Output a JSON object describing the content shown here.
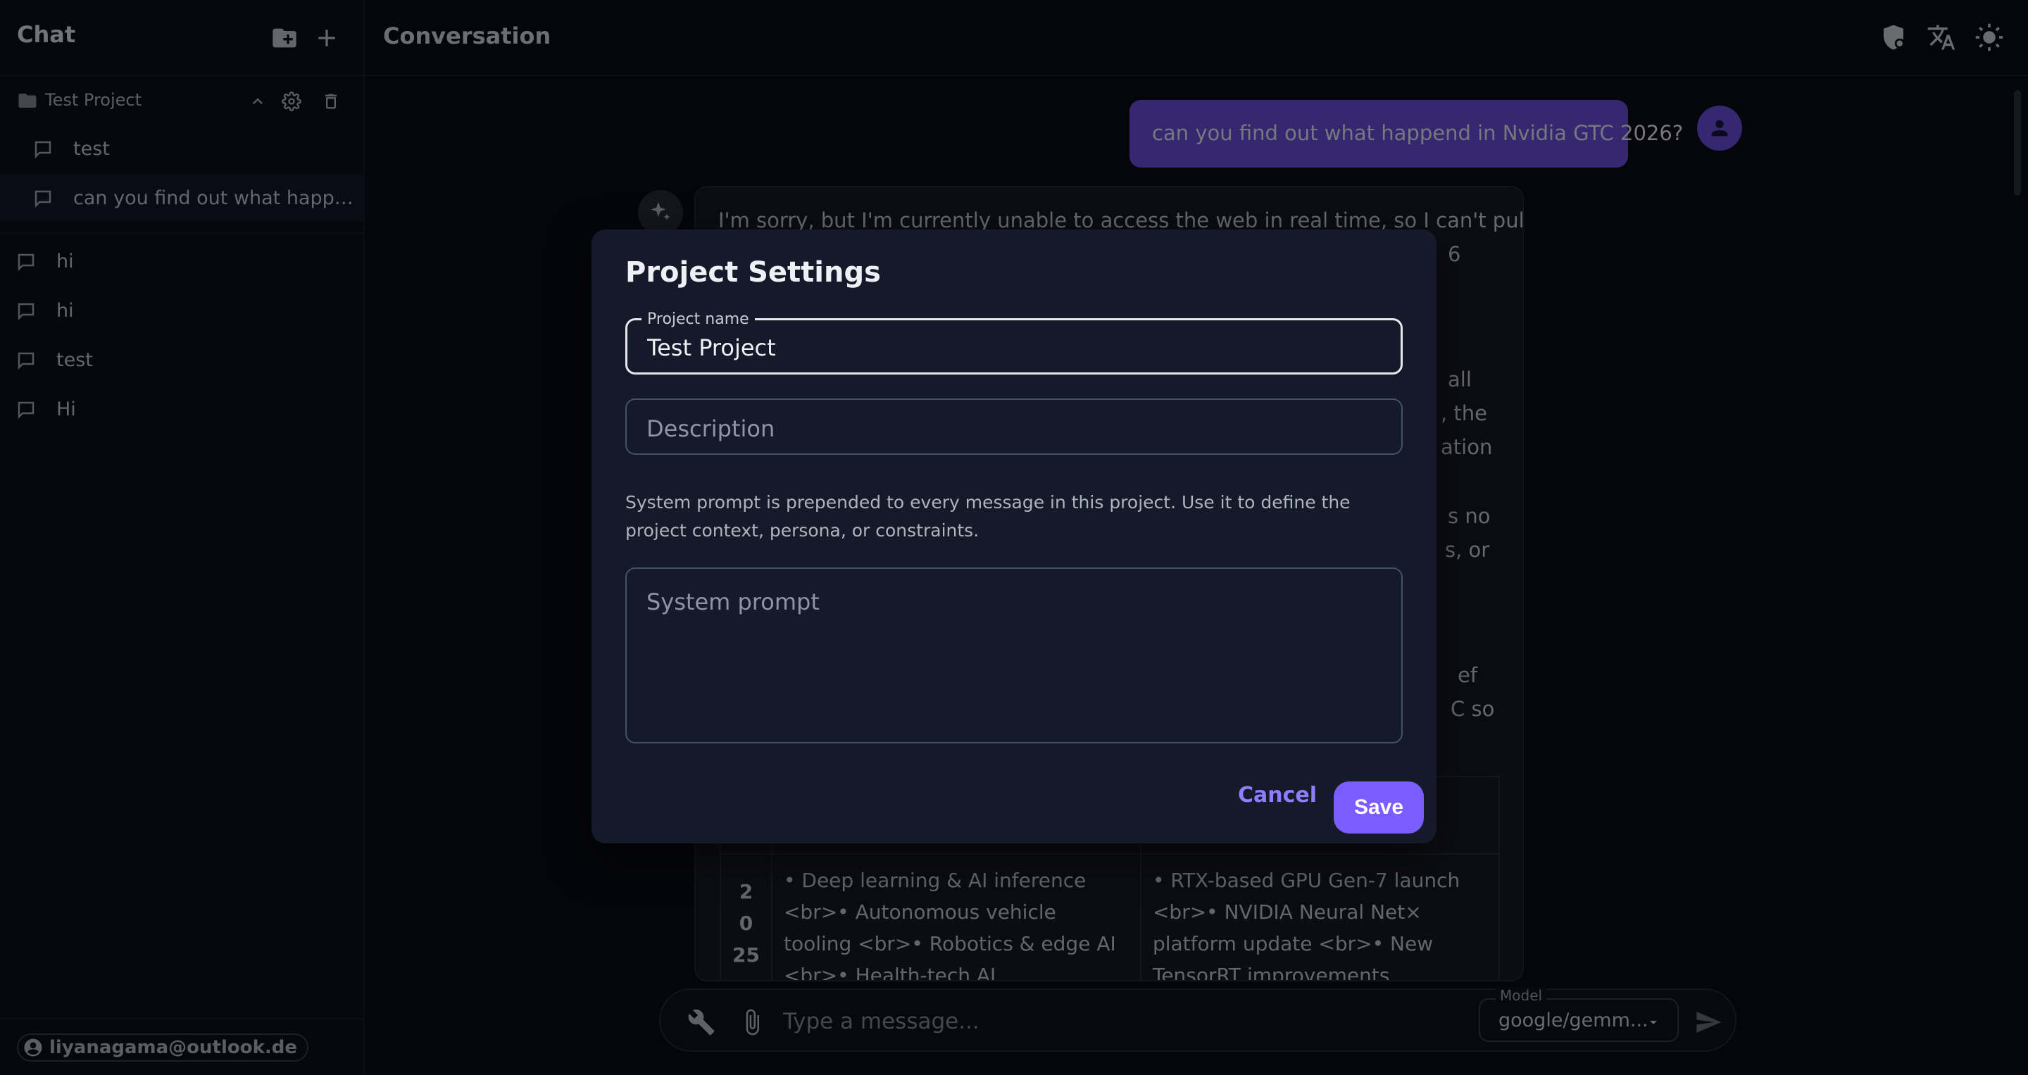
{
  "sidebar": {
    "title": "Chat",
    "project": {
      "name": "Test Project"
    },
    "project_conversations": [
      {
        "label": "test"
      },
      {
        "label": "can you find out what happe..."
      }
    ],
    "conversations": [
      {
        "label": "hi"
      },
      {
        "label": "hi"
      },
      {
        "label": "test"
      },
      {
        "label": "Hi"
      }
    ],
    "user_email": "liyanagama@outlook.de"
  },
  "header": {
    "title": "Conversation"
  },
  "messages": {
    "user_message": "can you find out what happend in Nvidia GTC 2026?",
    "assistant_lines": [
      "I'm sorry, but I'm currently unable to access the web in real time, so I can't pull",
      "6",
      "all",
      ", the",
      "ation",
      "s no",
      "s, or",
      "ef",
      "C so"
    ],
    "table": {
      "year": "2 0 25",
      "col1": "• Deep learning & AI inference <br>• Autonomous vehicle tooling <br>• Robotics & edge AI <br>• Health-tech AI",
      "col2": "• RTX-based GPU Gen-7 launch <br>• NVIDIA Neural Net× platform update <br>• New TensorRT improvements"
    }
  },
  "composer": {
    "placeholder": "Type a message...",
    "model_label": "Model",
    "model_value": "google/gemm..."
  },
  "modal": {
    "title": "Project Settings",
    "name_label": "Project name",
    "name_value": "Test Project",
    "description_placeholder": "Description",
    "helper_text": "System prompt is prepended to every message in this project. Use it to define the project context, persona, or constraints.",
    "system_prompt_placeholder": "System prompt",
    "cancel_label": "Cancel",
    "save_label": "Save"
  },
  "colors": {
    "accent": "#7a5cff",
    "user_bubble": "#6b4fe0",
    "background": "#0b0d17",
    "modal_bg": "#141a2a"
  },
  "icons": {
    "sidebar_new_folder": "folder-plus-icon",
    "sidebar_new_chat": "plus-icon",
    "project_folder": "folder-icon",
    "chat_bubble": "chat-bubble-icon",
    "user": "account-circle-icon",
    "topbar": [
      "shield-icon",
      "translate-icon",
      "sun-icon"
    ],
    "composer": [
      "wrench-icon",
      "paperclip-icon",
      "send-icon"
    ]
  }
}
